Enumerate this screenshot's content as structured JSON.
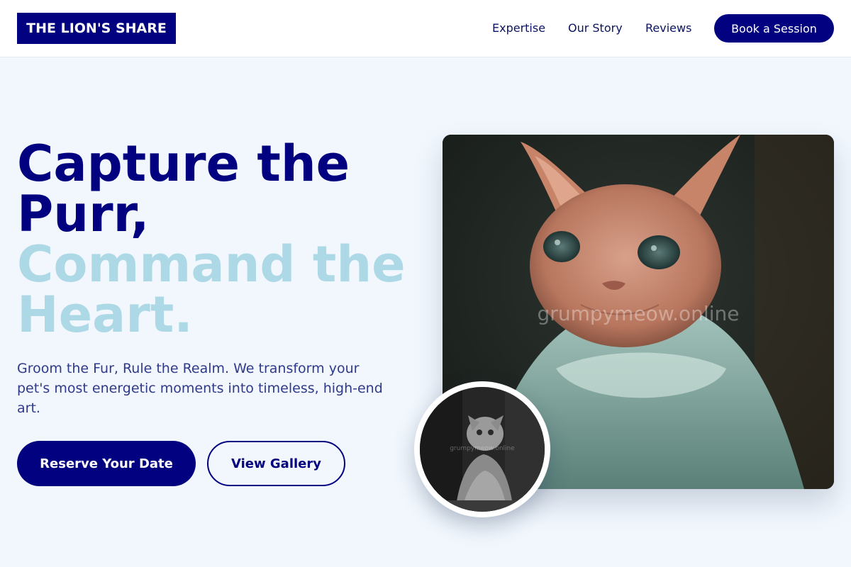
{
  "header": {
    "logo": "THE LION'S SHARE",
    "nav": [
      "Expertise",
      "Our Story",
      "Reviews"
    ],
    "cta": "Book a Session"
  },
  "hero": {
    "headline_dark": "Capture the Purr,",
    "headline_light": "Command the Heart.",
    "subtext": "Groom the Fur, Rule the Realm. We transform your pet's most energetic moments into timeless, high-end art.",
    "primary_button": "Reserve Your Date",
    "secondary_button": "View Gallery",
    "image_watermark": "grumpymeow.online",
    "circle_watermark": "grumpymeow.online"
  },
  "colors": {
    "brand": "#02017f",
    "accent_light": "#add8e6",
    "background": "#f1f7fd"
  }
}
